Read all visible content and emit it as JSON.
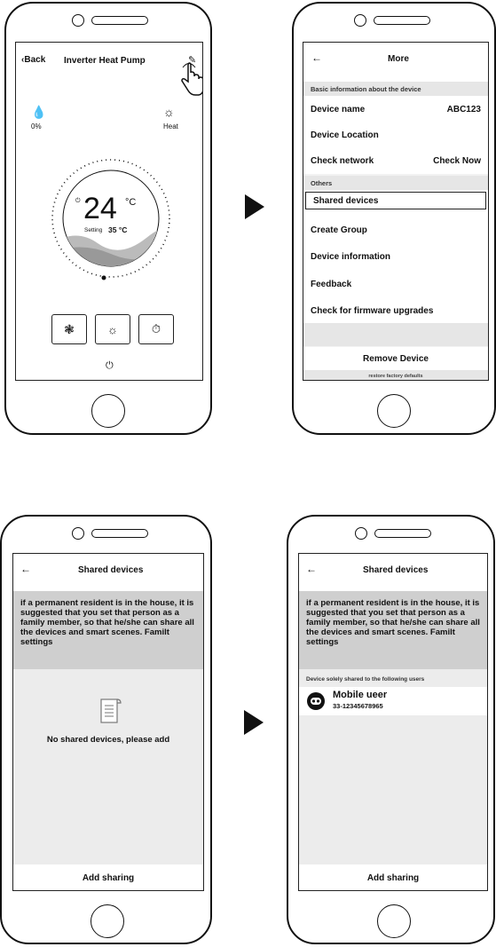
{
  "screen1": {
    "back_label": "Back",
    "title": "Inverter Heat Pump",
    "humidity_value": "0%",
    "mode_label": "Heat",
    "temperature": "24",
    "temp_unit": "°C",
    "setting_label": "Setting",
    "setting_value": "35 °C"
  },
  "screen2": {
    "title": "More",
    "section_basic": "Basic information about the device",
    "items_basic": [
      {
        "label": "Device name",
        "value": "ABC123"
      },
      {
        "label": "Device Location",
        "value": ""
      },
      {
        "label": "Check network",
        "value": "Check Now"
      }
    ],
    "section_others": "Others",
    "items_others": [
      {
        "label": "Shared devices"
      },
      {
        "label": "Create Group"
      },
      {
        "label": "Device information"
      },
      {
        "label": "Feedback"
      },
      {
        "label": "Check for firmware upgrades"
      }
    ],
    "remove_label": "Remove Device",
    "restore_label": "restore factory defaults"
  },
  "screen3": {
    "title": "Shared devices",
    "notice": "if a permanent resident is in the house, it is suggested that you set that person as a family member, so that he/she can share all the devices and smart scenes. Familt settings",
    "empty_text": "No shared devices, please add",
    "add_label": "Add sharing"
  },
  "screen4": {
    "title": "Shared devices",
    "notice": "if a permanent resident is in the house, it is suggested that you set that person as a family member, so that he/she can share all the devices and smart scenes. Familt settings",
    "section_label": "Device solely shared to the following users",
    "user_name": "Mobile ueer",
    "user_phone": "33-12345678965",
    "add_label": "Add sharing"
  }
}
